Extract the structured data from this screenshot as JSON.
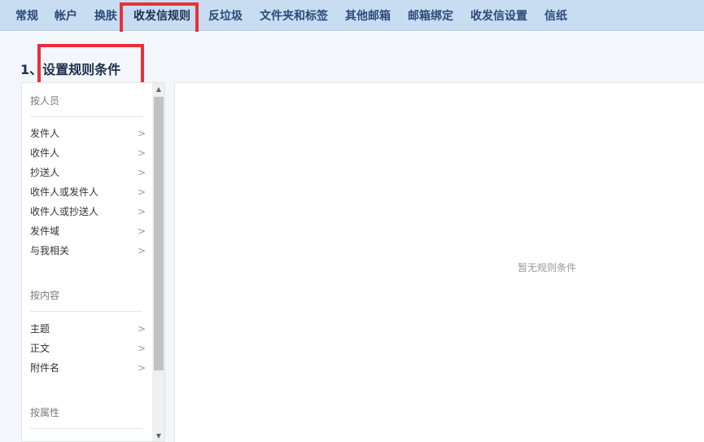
{
  "tabs": [
    {
      "label": "常规"
    },
    {
      "label": "帐户"
    },
    {
      "label": "换肤"
    },
    {
      "label": "收发信规则",
      "active": true
    },
    {
      "label": "反垃圾"
    },
    {
      "label": "文件夹和标签"
    },
    {
      "label": "其他邮箱"
    },
    {
      "label": "邮箱绑定"
    },
    {
      "label": "收发信设置"
    },
    {
      "label": "信纸"
    }
  ],
  "section": {
    "title": "1、设置规则条件"
  },
  "conditions": {
    "groups": [
      {
        "heading": "按人员",
        "items": [
          "发件人",
          "收件人",
          "抄送人",
          "收件人或发件人",
          "收件人或抄送人",
          "发件域",
          "与我相关"
        ]
      },
      {
        "heading": "按内容",
        "items": [
          "主题",
          "正文",
          "附件名"
        ]
      },
      {
        "heading": "按属性",
        "items": []
      }
    ],
    "item_icon": "chevron-right-icon"
  },
  "rules_panel": {
    "empty_text": "暂无规则条件"
  },
  "colors": {
    "highlight": "#e8303a",
    "tab_bar": "#c9ddf2",
    "tab_text": "#2a4a77"
  }
}
